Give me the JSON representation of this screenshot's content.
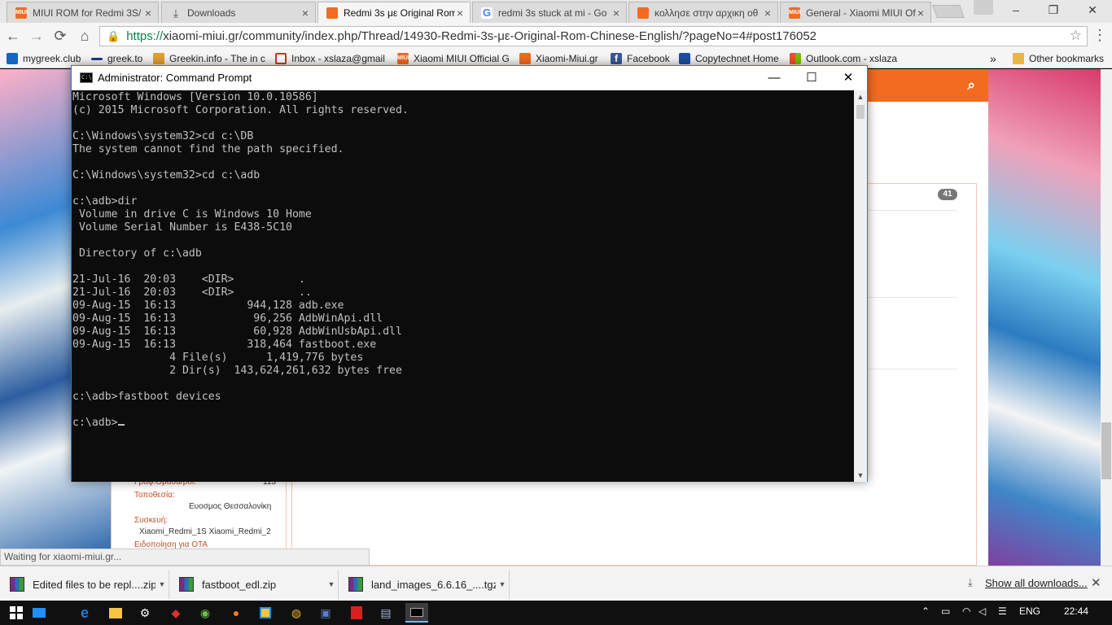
{
  "browser": {
    "tabs": [
      {
        "title": "MIUI ROM for Redmi 3S/",
        "icon": "miui-icon",
        "active": false
      },
      {
        "title": "Downloads",
        "icon": "download-icon",
        "active": false
      },
      {
        "title": "Redmi 3s με Original Rom",
        "icon": "xiaomi-miui-house-icon",
        "active": true
      },
      {
        "title": "redmi 3s stuck at mi - Go",
        "icon": "google-icon",
        "active": false
      },
      {
        "title": "κολλησε στην αρχικη οθ",
        "icon": "xiaomi-miui-house-icon",
        "active": false
      },
      {
        "title": "General - Xiaomi MIUI Of",
        "icon": "miui-icon",
        "active": false
      }
    ],
    "tab_close": "×",
    "window_controls": {
      "minimize": "–",
      "maximize": "❐",
      "close": "✕"
    },
    "nav": {
      "back": "←",
      "forward": "→",
      "reload": "⟳",
      "home": "⌂"
    },
    "url_scheme": "https://",
    "url_rest": "xiaomi-miui.gr/community/index.php/Thread/14930-Redmi-3s-με-Original-Rom-Chinese-English/?pageNo=4#post176052",
    "bookmarks": [
      {
        "label": "mygreek.club",
        "icon": "folder-check-icon",
        "color": "#1565c0"
      },
      {
        "label": "greek.to",
        "icon": "page-icon",
        "color": "#1a3a8a"
      },
      {
        "label": "Greekin.info - The in c",
        "icon": "greekin-icon",
        "color": "#e0a030"
      },
      {
        "label": "Inbox - xslaza@gmail",
        "icon": "gmail-icon",
        "color": "#d93025"
      },
      {
        "label": "Xiaomi MIUI Official G",
        "icon": "miui-icon",
        "color": "#f26b21"
      },
      {
        "label": "Xiaomi-Miui.gr",
        "icon": "xiaomi-miui-house-icon",
        "color": "#f26b21"
      },
      {
        "label": "Facebook",
        "icon": "facebook-icon",
        "color": "#3b5998"
      },
      {
        "label": "Copytechnet Home",
        "icon": "copytechnet-icon",
        "color": "#1d4fa0"
      },
      {
        "label": "Outlook.com - xslaza",
        "icon": "windows-icon",
        "color": "#f25022"
      }
    ],
    "bookmarks_overflow": "»",
    "other_bookmarks": "Other bookmarks",
    "status": "Waiting for xiaomi-miui.gr..."
  },
  "forum": {
    "badge_count": "41",
    "userinfo": [
      {
        "label": "Γραφ.Ομάδα/ροι:",
        "value": "113"
      },
      {
        "label": "Τοποθεσία:",
        "value": "Ευοσμος Θεσσαλονίκη"
      },
      {
        "label": "Συσκευή:",
        "value": "Xiaomi_Redmi_1S Xiaomi_Redmi_2"
      },
      {
        "label": "Ειδοποίηση για OTA",
        "value": ""
      }
    ]
  },
  "cmd": {
    "title": "Administrator: Command Prompt",
    "icon_text": "C:\\",
    "controls": {
      "minimize": "—",
      "maximize": "☐",
      "close": "✕"
    },
    "scroll_up": "▲",
    "scroll_down": "▼",
    "output": "Microsoft Windows [Version 10.0.10586]\n(c) 2015 Microsoft Corporation. All rights reserved.\n\nC:\\Windows\\system32>cd c:\\DB\nThe system cannot find the path specified.\n\nC:\\Windows\\system32>cd c:\\adb\n\nc:\\adb>dir\n Volume in drive C is Windows 10 Home\n Volume Serial Number is E438-5C10\n\n Directory of c:\\adb\n\n21-Jul-16  20:03    <DIR>          .\n21-Jul-16  20:03    <DIR>          ..\n09-Aug-15  16:13           944,128 adb.exe\n09-Aug-15  16:13            96,256 AdbWinApi.dll\n09-Aug-15  16:13            60,928 AdbWinUsbApi.dll\n09-Aug-15  16:13           318,464 fastboot.exe\n               4 File(s)      1,419,776 bytes\n               2 Dir(s)  143,624,261,632 bytes free\n\nc:\\adb>fastboot devices\n\nc:\\adb>"
  },
  "downloads": {
    "items": [
      {
        "name": "Edited files to be repl....zip"
      },
      {
        "name": "fastboot_edl.zip"
      },
      {
        "name": "land_images_6.6.16_....tgz"
      }
    ],
    "caret": "▼",
    "show_all": "Show all downloads...",
    "close": "✕"
  },
  "taskbar": {
    "language": "ENG",
    "time": "22:44",
    "accent": "#76b9ed"
  }
}
